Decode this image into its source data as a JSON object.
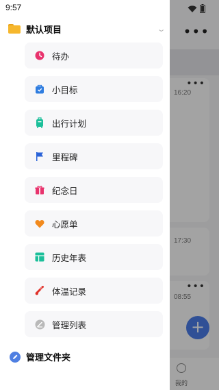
{
  "status_bar": {
    "time": "9:57"
  },
  "drawer": {
    "project": {
      "title": "默认项目"
    },
    "items": [
      {
        "label": "待办",
        "icon": "clock-icon",
        "color": "#e8336d"
      },
      {
        "label": "小目标",
        "icon": "target-bag-icon",
        "color": "#2f7de0"
      },
      {
        "label": "出行计划",
        "icon": "luggage-icon",
        "color": "#1bbf9a"
      },
      {
        "label": "里程碑",
        "icon": "flag-icon",
        "color": "#2a63d8"
      },
      {
        "label": "纪念日",
        "icon": "gift-icon",
        "color": "#e8336d"
      },
      {
        "label": "心愿单",
        "icon": "heart-icon",
        "color": "#f28a1d"
      },
      {
        "label": "历史年表",
        "icon": "table-icon",
        "color": "#1bbf9a"
      },
      {
        "label": "体温记录",
        "icon": "thermometer-icon",
        "color": "#e0322a"
      },
      {
        "label": "管理列表",
        "icon": "manage-list-icon",
        "color": "#b9b9b9"
      }
    ],
    "manage_folders": {
      "label": "管理文件夹"
    }
  },
  "background": {
    "cards": [
      {
        "time": "16:20"
      },
      {
        "time": "17:30"
      },
      {
        "time": "08:55"
      }
    ],
    "bottom_nav": {
      "me_label": "我的"
    }
  }
}
